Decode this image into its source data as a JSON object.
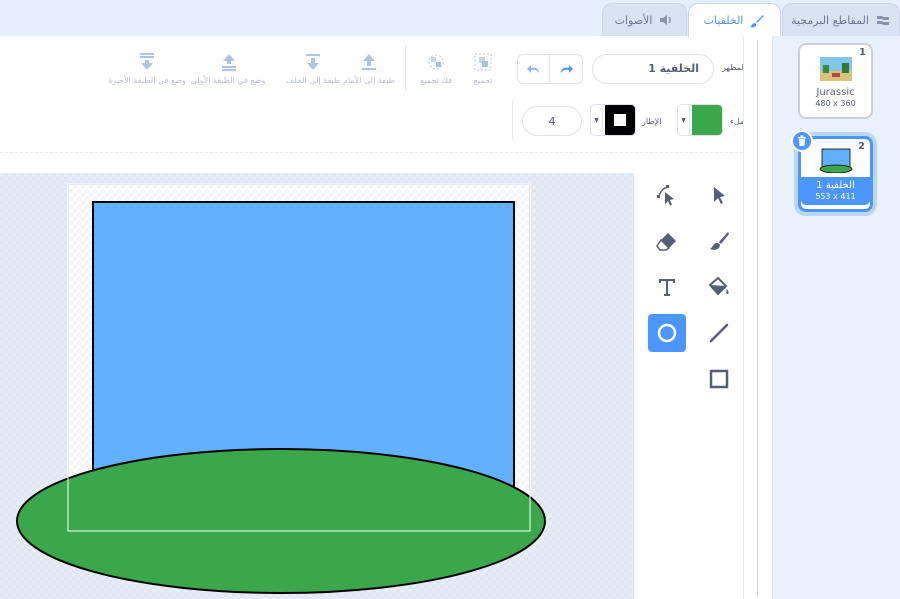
{
  "tabs": {
    "code_label": "المقاطع البرمجية",
    "backdrops_label": "الخلفيات",
    "sounds_label": "الأصوات"
  },
  "toolbar": {
    "costume_label": "المظهر",
    "costume_name": "الخلفية 1",
    "group_label": "تجميع",
    "ungroup_label": "فك تجميع",
    "forward_label": "طبقة إلى الأمام",
    "backward_label": "طبقة إلى الخلف",
    "front_label": "وضع في الطبقة الأولى",
    "back_label": "وضع في الطبقة الأخيرة",
    "fill_label": "ملء",
    "outline_label": "الإطار",
    "outline_width": "4",
    "fill_color": "#3aa84a",
    "outline_color": "#000000"
  },
  "tools": [
    "select-arrow",
    "reshape",
    "brush",
    "eraser",
    "fill",
    "text",
    "line",
    "circle",
    "rectangle"
  ],
  "active_tool": "circle",
  "backdrops": [
    {
      "number": "1",
      "name": "Jurassic",
      "size": "480 x 360"
    },
    {
      "number": "2",
      "name": "الخلفية 1",
      "size": "553 x 411"
    }
  ],
  "colors": {
    "accent": "#4c97ff",
    "sky_blue": "#62b1ff",
    "grass_green": "#3aa84a"
  }
}
